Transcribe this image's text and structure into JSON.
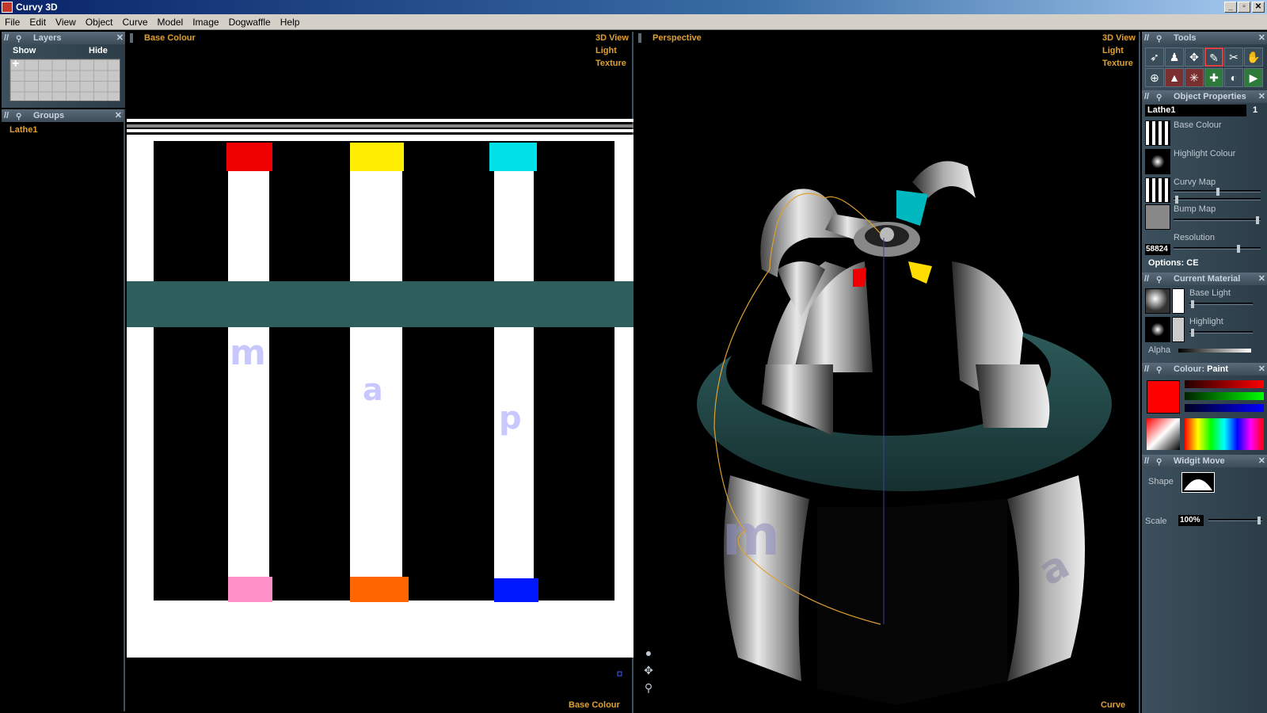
{
  "window": {
    "title": "Curvy 3D",
    "btn_min": "_",
    "btn_max": "▫",
    "btn_close": "✕"
  },
  "menu": [
    "File",
    "Edit",
    "View",
    "Object",
    "Curve",
    "Model",
    "Image",
    "Dogwaffle",
    "Help"
  ],
  "layers": {
    "title": "Layers",
    "show": "Show",
    "hide": "Hide"
  },
  "groups": {
    "title": "Groups",
    "items": [
      "Lathe1"
    ]
  },
  "left_view": {
    "name": "Base Colour",
    "modes": [
      "3D View",
      "Light",
      "Texture"
    ],
    "footer": "Base Colour",
    "letters": [
      "m",
      "a",
      "p"
    ]
  },
  "right_view": {
    "name": "Perspective",
    "modes": [
      "3D View",
      "Light",
      "Texture"
    ],
    "footer": "Curve"
  },
  "tools": {
    "title": "Tools"
  },
  "object_properties": {
    "title": "Object Properties",
    "object_name": "Lathe1",
    "object_count": "1",
    "base_colour": "Base Colour",
    "highlight_colour": "Highlight Colour",
    "curvy_map": "Curvy Map",
    "bump_map": "Bump Map",
    "resolution_label": "Resolution",
    "resolution_value": "58824",
    "options": "Options: CE"
  },
  "current_material": {
    "title": "Current Material",
    "base_light": "Base Light",
    "highlight": "Highlight",
    "alpha": "Alpha"
  },
  "colour": {
    "title": "Colour:",
    "mode": "Paint",
    "swatch": "#ff0000"
  },
  "widgit": {
    "title": "Widgit Move",
    "shape": "Shape",
    "scale_label": "Scale",
    "scale_value": "100%"
  },
  "colors": {
    "teal": "#2f5e5e",
    "red": "#ee0000",
    "yellow": "#ffee00",
    "cyan": "#00e0e8",
    "pink": "#ff90c8",
    "orange": "#ff6600",
    "blue": "#0018ff",
    "letter": "#c8c8ff"
  }
}
